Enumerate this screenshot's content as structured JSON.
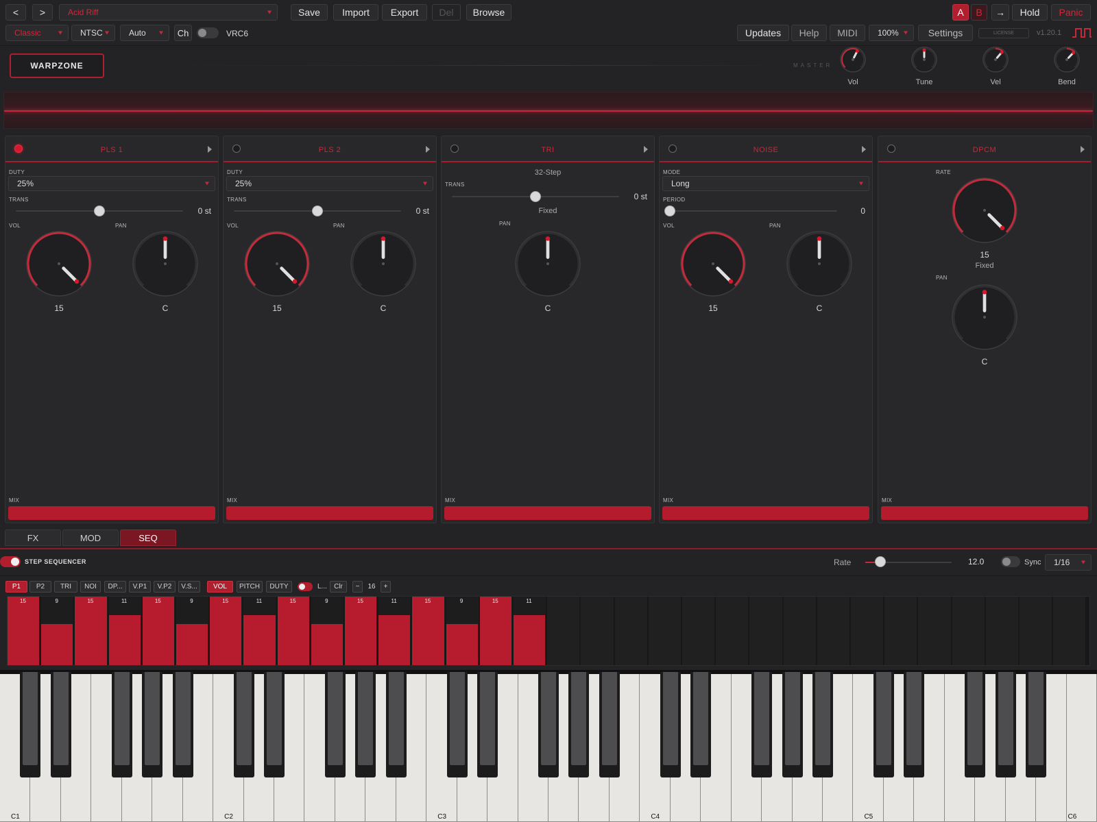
{
  "toolbar": {
    "prev": "<",
    "next": ">",
    "preset": "Acid Riff",
    "save": "Save",
    "import": "Import",
    "export": "Export",
    "del": "Del",
    "browse": "Browse",
    "a": "A",
    "b": "B",
    "arrow": "→",
    "hold": "Hold",
    "panic": "Panic"
  },
  "toolbar2": {
    "mode": "Classic",
    "region": "NTSC",
    "auto": "Auto",
    "ch": "Ch",
    "vrc6_label": "VRC6",
    "updates": "Updates",
    "help": "Help",
    "midi": "MIDI",
    "zoom": "100%",
    "settings": "Settings",
    "license": "LICENSE",
    "version": "v1.20.1"
  },
  "header": {
    "logo": "WARPZONE",
    "master_label": "MASTER",
    "knobs": [
      {
        "label": "Vol",
        "value": 0.6
      },
      {
        "label": "Tune",
        "value": 0.5
      },
      {
        "label": "Vel",
        "value": 0.65
      },
      {
        "label": "Bend",
        "value": 0.66
      }
    ]
  },
  "panels": [
    {
      "title": "PLS 1",
      "led_on": true,
      "duty_label": "DUTY",
      "duty": "25%",
      "trans_label": "TRANS",
      "trans": "0 st",
      "trans_pos": 0.5,
      "vol_label": "VOL",
      "vol": "15",
      "vol_value": 1.0,
      "pan_label": "PAN",
      "pan": "C",
      "mix_label": "MIX"
    },
    {
      "title": "PLS 2",
      "led_on": false,
      "duty_label": "DUTY",
      "duty": "25%",
      "trans_label": "TRANS",
      "trans": "0 st",
      "trans_pos": 0.5,
      "vol_label": "VOL",
      "vol": "15",
      "vol_value": 1.0,
      "pan_label": "PAN",
      "pan": "C",
      "mix_label": "MIX"
    },
    {
      "title": "TRI",
      "led_on": false,
      "steps": "32-Step",
      "trans_label": "TRANS",
      "trans": "0 st",
      "trans_pos": 0.5,
      "fixed": "Fixed",
      "pan_label": "PAN",
      "pan": "C",
      "mix_label": "MIX"
    },
    {
      "title": "NOISE",
      "led_on": false,
      "mode_label": "MODE",
      "mode": "Long",
      "period_label": "PERIOD",
      "period": "0",
      "period_pos": 0.0,
      "vol_label": "VOL",
      "vol": "15",
      "vol_value": 1.0,
      "pan_label": "PAN",
      "pan": "C",
      "mix_label": "MIX"
    },
    {
      "title": "DPCM",
      "led_on": false,
      "rate_label": "RATE",
      "rate": "15",
      "rate_value": 1.0,
      "fixed": "Fixed",
      "pan_label": "PAN",
      "pan": "C",
      "mix_label": "MIX"
    }
  ],
  "tabs": [
    "FX",
    "MOD",
    "SEQ"
  ],
  "sequencer": {
    "label": "STEP SEQUENCER",
    "rate_label": "Rate",
    "rate": "12.0",
    "rate_pos": 0.1,
    "sync_label": "Sync",
    "division": "1/16",
    "lanes": [
      "P1",
      "P2",
      "TRI",
      "NOI",
      "DP...",
      "V.P1",
      "V.P2",
      "V.S..."
    ],
    "params": [
      "VOL",
      "PITCH",
      "DUTY"
    ],
    "loop_label": "L...",
    "clear": "Clr",
    "minus": "−",
    "length": "16",
    "plus": "+",
    "max": 15,
    "steps": [
      15,
      9,
      15,
      11,
      15,
      9,
      15,
      11,
      15,
      9,
      15,
      11,
      15,
      9,
      15,
      11
    ],
    "total_steps": 32
  },
  "keyboard": {
    "labels": [
      "C1",
      "C2",
      "C3",
      "C4",
      "C5",
      "C6"
    ]
  },
  "colors": {
    "accent": "#b61c2d",
    "bg": "#232325"
  }
}
